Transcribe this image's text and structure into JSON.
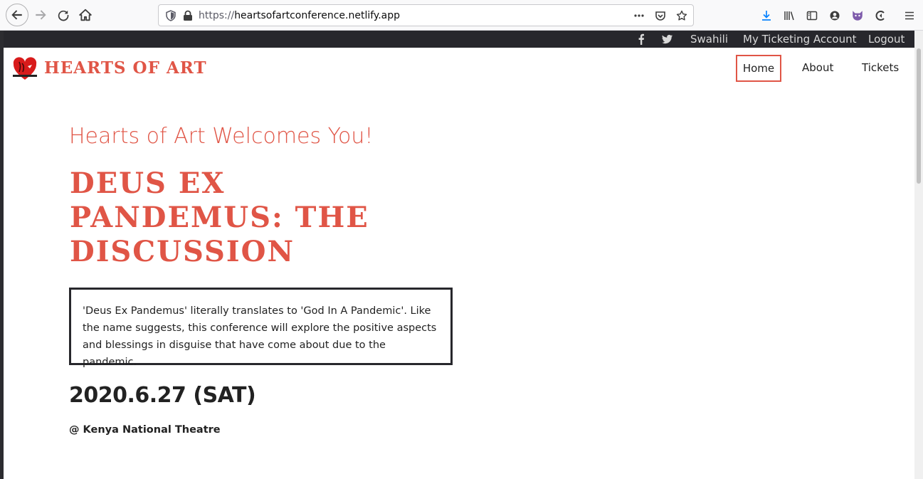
{
  "browser": {
    "url_prefix": "https://",
    "url_host": "heartsofartconference.netlify.app"
  },
  "topbar": {
    "language": "Swahili",
    "ticketing": "My Ticketing Account",
    "logout": "Logout"
  },
  "header": {
    "logo_text": "Hearts of Art",
    "nav": {
      "home": "Home",
      "about": "About",
      "tickets": "Tickets"
    }
  },
  "main": {
    "welcome": "Hearts of Art Welcomes You!",
    "title": "Deus Ex Pandemus: The Discussion",
    "description": "'Deus Ex Pandemus' literally translates to 'God In A Pandemic'. Like the name suggests, this conference will explore the positive aspects and blessings in disguise that have come about due to the pandemic.",
    "date": "2020.6.27 (SAT)",
    "venue": "@ Kenya National Theatre"
  },
  "colors": {
    "accent": "#e05546",
    "dark": "#27272c"
  }
}
